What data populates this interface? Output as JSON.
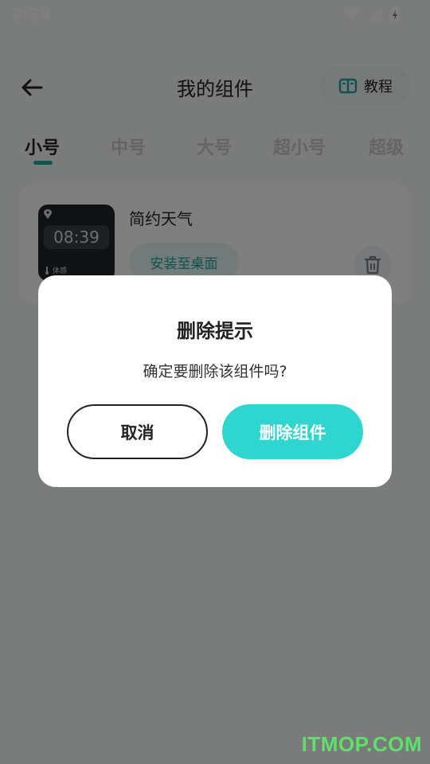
{
  "status_bar": {
    "time": "8:39",
    "icons": [
      "wifi-icon",
      "signal-icon",
      "battery-charging-icon"
    ]
  },
  "header": {
    "title": "我的组件",
    "back_icon": "arrow-left-icon",
    "tutorial_label": "教程",
    "tutorial_icon": "book-icon"
  },
  "tabs": [
    {
      "label": "小号",
      "active": true
    },
    {
      "label": "中号",
      "active": false
    },
    {
      "label": "大号",
      "active": false
    },
    {
      "label": "超小号",
      "active": false
    },
    {
      "label": "超级",
      "active": false
    }
  ],
  "widget": {
    "name": "简约天气",
    "preview_time": "08:39",
    "preview_label": "体感",
    "install_label": "安装至桌面",
    "delete_icon": "trash-icon"
  },
  "dialog": {
    "title": "删除提示",
    "message": "确定要删除该组件吗?",
    "cancel_label": "取消",
    "confirm_label": "删除组件"
  },
  "watermark": "ITMOP.COM",
  "colors": {
    "accent": "#2fd6cf",
    "accent_dark": "#1fa7a1",
    "overlay": "rgba(0,0,0,0.5)"
  }
}
